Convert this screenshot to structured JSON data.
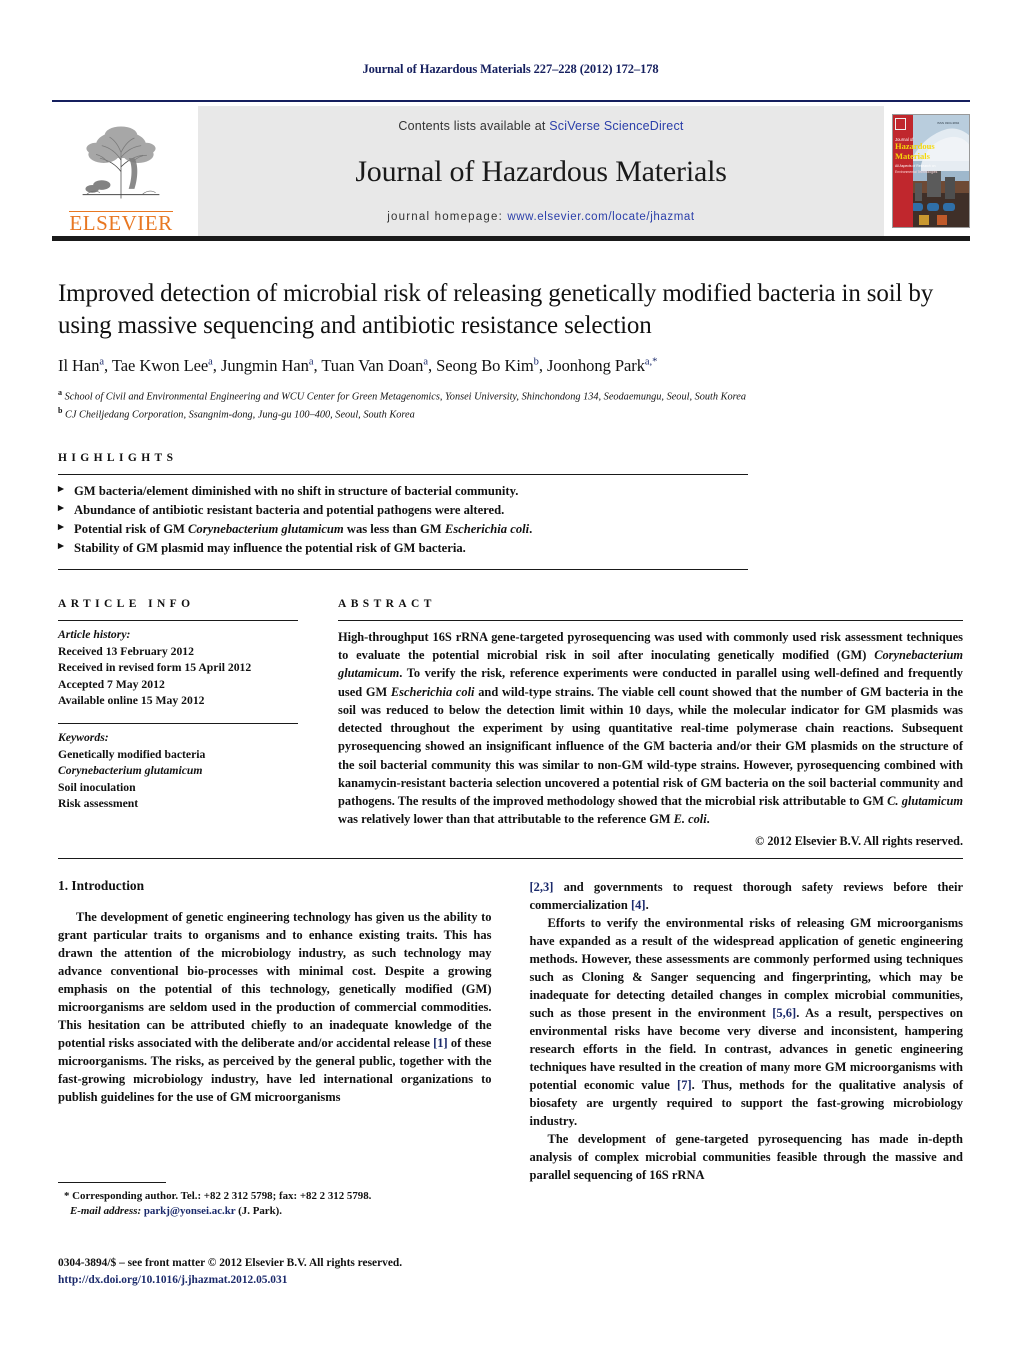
{
  "running_head": "Journal of Hazardous Materials 227–228 (2012) 172–178",
  "masthead": {
    "contents_prefix": "Contents lists available at ",
    "contents_link": "SciVerse ScienceDirect",
    "journal_title": "Journal of Hazardous Materials",
    "homepage_prefix": "journal homepage: ",
    "homepage_url": "www.elsevier.com/locate/jhazmat",
    "publisher_word": "ELSEVIER",
    "cover_line1": "Journal of",
    "cover_line2": "Hazardous",
    "cover_line3": "Materials",
    "cover_sub": "All Aspects of Research on",
    "cover_sub2": "Environmental Technologies"
  },
  "article": {
    "title": "Improved detection of microbial risk of releasing genetically modified bacteria in soil by using massive sequencing and antibiotic resistance selection",
    "authors": [
      {
        "name": "Il Han",
        "sup": "a"
      },
      {
        "name": "Tae Kwon Lee",
        "sup": "a"
      },
      {
        "name": "Jungmin Han",
        "sup": "a"
      },
      {
        "name": "Tuan Van Doan",
        "sup": "a"
      },
      {
        "name": "Seong Bo Kim",
        "sup": "b"
      },
      {
        "name": "Joonhong Park",
        "sup": "a,*"
      }
    ],
    "affiliations": [
      {
        "marker": "a",
        "text": "School of Civil and Environmental Engineering and WCU Center for Green Metagenomics, Yonsei University, Shinchondong 134, Seodaemungu, Seoul, South Korea"
      },
      {
        "marker": "b",
        "text": "CJ Cheiljedang Corporation, Ssangnim-dong, Jung-gu 100–400, Seoul, South Korea"
      }
    ]
  },
  "highlights": {
    "label": "HIGHLIGHTS",
    "items": [
      {
        "pre": "GM bacteria/element diminished with no shift in structure of bacterial community.",
        "italic": "",
        "post": ""
      },
      {
        "pre": "Abundance of antibiotic resistant bacteria and potential pathogens were altered.",
        "italic": "",
        "post": ""
      },
      {
        "pre": "Potential risk of GM ",
        "italic": "Corynebacterium glutamicum",
        "post": " was less than GM ",
        "italic2": "Escherichia coli",
        "post2": "."
      },
      {
        "pre": "Stability of GM plasmid may influence the potential risk of GM bacteria.",
        "italic": "",
        "post": ""
      }
    ]
  },
  "article_info": {
    "label": "ARTICLE INFO",
    "history_label": "Article history:",
    "history": [
      "Received 13 February 2012",
      "Received in revised form 15 April 2012",
      "Accepted 7 May 2012",
      "Available online 15 May 2012"
    ],
    "keywords_label": "Keywords:",
    "keywords": [
      {
        "text": "Genetically modified bacteria",
        "italic": false
      },
      {
        "text": "Corynebacterium glutamicum",
        "italic": true
      },
      {
        "text": "Soil inoculation",
        "italic": false
      },
      {
        "text": "Risk assessment",
        "italic": false
      }
    ]
  },
  "abstract": {
    "label": "ABSTRACT",
    "paragraph_parts": [
      {
        "t": "High-throughput 16S rRNA gene-targeted pyrosequencing was used with commonly used risk assessment techniques to evaluate the potential microbial risk in soil after inoculating genetically modified (GM) ",
        "i": false
      },
      {
        "t": "Corynebacterium glutamicum",
        "i": true
      },
      {
        "t": ". To verify the risk, reference experiments were conducted in parallel using well-defined and frequently used GM ",
        "i": false
      },
      {
        "t": "Escherichia coli",
        "i": true
      },
      {
        "t": " and wild-type strains. The viable cell count showed that the number of GM bacteria in the soil was reduced to below the detection limit within 10 days, while the molecular indicator for GM plasmids was detected throughout the experiment by using quantitative real-time polymerase chain reactions. Subsequent pyrosequencing showed an insignificant influence of the GM bacteria and/or their GM plasmids on the structure of the soil bacterial community this was similar to non-GM wild-type strains. However, pyrosequencing combined with kanamycin-resistant bacteria selection uncovered a potential risk of GM bacteria on the soil bacterial community and pathogens. The results of the improved methodology showed that the microbial risk attributable to GM ",
        "i": false
      },
      {
        "t": "C. glutamicum",
        "i": true
      },
      {
        "t": " was relatively lower than that attributable to the reference GM ",
        "i": false
      },
      {
        "t": "E. coli",
        "i": true
      },
      {
        "t": ".",
        "i": false
      }
    ],
    "copyright": "© 2012 Elsevier B.V. All rights reserved."
  },
  "body": {
    "section_heading": "1.  Introduction",
    "left_paragraphs": [
      {
        "parts": [
          {
            "t": "The development of genetic engineering technology has given us the ability to grant particular traits to organisms and to enhance existing traits. This has drawn the attention of the microbiology industry, as such technology may advance conventional bio-processes with minimal cost. Despite a growing emphasis on the potential of this technology, genetically modified (GM) microorganisms are seldom used in the production of commercial commodities. This hesitation can be attributed chiefly to an inadequate knowledge of the potential risks associated with the deliberate and/or accidental release ",
            "k": "plain"
          },
          {
            "t": "[1]",
            "k": "ref"
          },
          {
            "t": " of these microorganisms. The risks, as perceived by the general public, together with the fast-growing microbiology industry, have led international organizations to publish guidelines for the use of GM microorganisms",
            "k": "plain"
          }
        ]
      }
    ],
    "right_paragraphs": [
      {
        "indent": false,
        "parts": [
          {
            "t": "[2,3]",
            "k": "ref"
          },
          {
            "t": " and governments to request thorough safety reviews before their commercialization ",
            "k": "plain"
          },
          {
            "t": "[4]",
            "k": "ref"
          },
          {
            "t": ".",
            "k": "plain"
          }
        ]
      },
      {
        "indent": true,
        "parts": [
          {
            "t": "Efforts to verify the environmental risks of releasing GM microorganisms have expanded as a result of the widespread application of genetic engineering methods. However, these assessments are commonly performed using techniques such as Cloning & Sanger sequencing and fingerprinting, which may be inadequate for detecting detailed changes in complex microbial communities, such as those present in the environment ",
            "k": "plain"
          },
          {
            "t": "[5,6]",
            "k": "ref"
          },
          {
            "t": ". As a result, perspectives on environmental risks have become very diverse and inconsistent, hampering research efforts in the field. In contrast, advances in genetic engineering techniques have resulted in the creation of many more GM microorganisms with potential economic value ",
            "k": "plain"
          },
          {
            "t": "[7]",
            "k": "ref"
          },
          {
            "t": ". Thus, methods for the qualitative analysis of biosafety are urgently required to support the fast-growing microbiology industry.",
            "k": "plain"
          }
        ]
      },
      {
        "indent": true,
        "parts": [
          {
            "t": "The development of gene-targeted pyrosequencing has made in-depth analysis of complex microbial communities feasible through the massive and parallel sequencing of 16S rRNA",
            "k": "plain"
          }
        ]
      }
    ]
  },
  "footnote": {
    "star": "*",
    "corresponding": " Corresponding author. Tel.: +82 2 312 5798; fax: +82 2 312 5798.",
    "email_label": "E-mail address:",
    "email": "parkj@yonsei.ac.kr",
    "email_suffix": " (J. Park)."
  },
  "imprint": {
    "line1": "0304-3894/$ – see front matter © 2012 Elsevier B.V. All rights reserved.",
    "doi": "http://dx.doi.org/10.1016/j.jhazmat.2012.05.031"
  },
  "colors": {
    "link_blue": "#2b3faa",
    "ref_blue": "#1b2a6b",
    "elsevier_orange": "#e87722",
    "grey_box": "#e8e8e8",
    "running_head": "#151f5e"
  }
}
